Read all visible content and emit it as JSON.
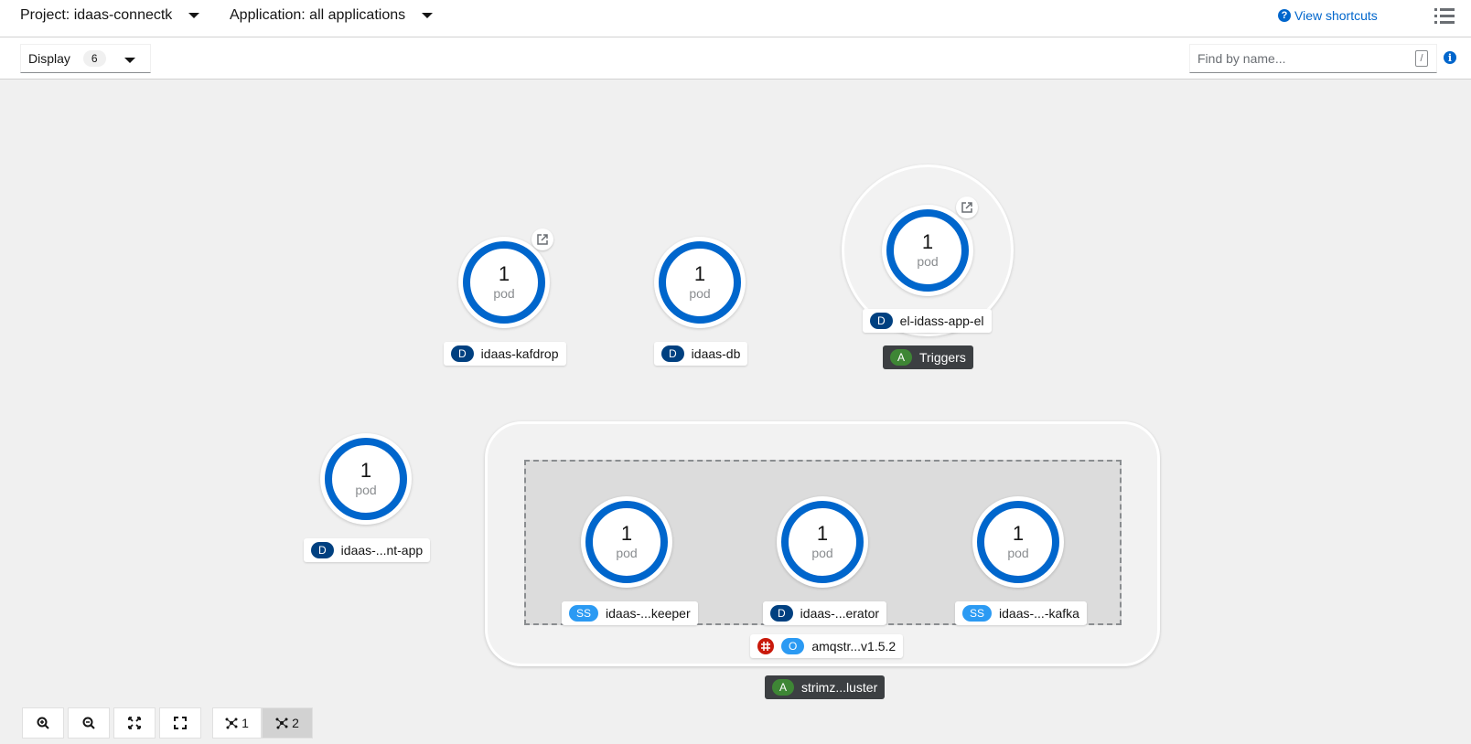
{
  "header": {
    "project_label": "Project: idaas-connectk",
    "application_label": "Application: all applications",
    "shortcuts_label": "View shortcuts"
  },
  "toolbar": {
    "display_label": "Display",
    "display_count": "6",
    "find_placeholder": "Find by name...",
    "find_shortcut": "/"
  },
  "nodes": {
    "kafdrop": {
      "count": "1",
      "unit": "pod",
      "badge": "D",
      "name": "idaas-kafdrop"
    },
    "db": {
      "count": "1",
      "unit": "pod",
      "badge": "D",
      "name": "idaas-db"
    },
    "el": {
      "count": "1",
      "unit": "pod",
      "badge": "D",
      "name": "el-idass-app-el"
    },
    "ntapp": {
      "count": "1",
      "unit": "pod",
      "badge": "D",
      "name": "idaas-...nt-app"
    },
    "keeper": {
      "count": "1",
      "unit": "pod",
      "badge": "SS",
      "name": "idaas-...keeper"
    },
    "erator": {
      "count": "1",
      "unit": "pod",
      "badge": "D",
      "name": "idaas-...erator"
    },
    "kafka": {
      "count": "1",
      "unit": "pod",
      "badge": "SS",
      "name": "idaas-...-kafka"
    }
  },
  "groups": {
    "triggers": {
      "badge": "A",
      "name": "Triggers"
    },
    "operator": {
      "badge": "O",
      "name": "amqstr...v1.5.2"
    },
    "strimzi": {
      "badge": "A",
      "name": "strimz...luster"
    }
  },
  "controls": {
    "layout1": "1",
    "layout2": "2"
  },
  "colors": {
    "pod_ring": "#0066cc",
    "deployment_badge": "#004080",
    "statefulset_badge": "#2b9af3",
    "application_badge": "#3e8635",
    "link": "#0066cc"
  }
}
